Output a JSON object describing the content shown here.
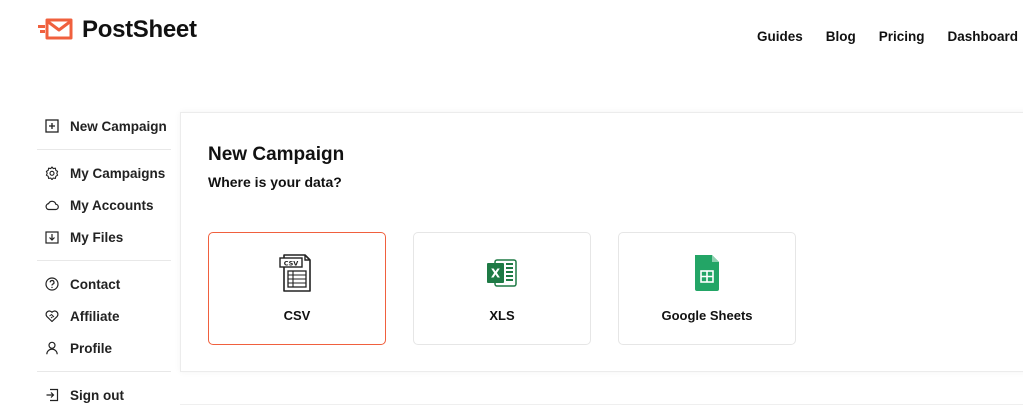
{
  "brand": {
    "name": "PostSheet",
    "color": "#f0603e"
  },
  "topnav": [
    {
      "label": "Guides"
    },
    {
      "label": "Blog"
    },
    {
      "label": "Pricing"
    },
    {
      "label": "Dashboard"
    }
  ],
  "sidebar": {
    "groups": [
      [
        {
          "label": "New Campaign",
          "icon": "plus-square-icon"
        }
      ],
      [
        {
          "label": "My Campaigns",
          "icon": "gear-icon"
        },
        {
          "label": "My Accounts",
          "icon": "cloud-icon"
        },
        {
          "label": "My Files",
          "icon": "download-folder-icon"
        }
      ],
      [
        {
          "label": "Contact",
          "icon": "question-circle-icon"
        },
        {
          "label": "Affiliate",
          "icon": "heart-handshake-icon"
        },
        {
          "label": "Profile",
          "icon": "user-icon"
        }
      ],
      [
        {
          "label": "Sign out",
          "icon": "sign-out-icon"
        }
      ]
    ]
  },
  "main": {
    "title": "New Campaign",
    "subtitle": "Where is your data?",
    "options": [
      {
        "label": "CSV",
        "icon": "csv-file-icon",
        "selected": true
      },
      {
        "label": "XLS",
        "icon": "excel-icon",
        "selected": false
      },
      {
        "label": "Google Sheets",
        "icon": "google-sheets-icon",
        "selected": false
      }
    ],
    "csv_icon_text": "CSV",
    "xls_icon_text": "X"
  },
  "colors": {
    "accent": "#f0603e",
    "excel": "#1e7a45",
    "sheets": "#23a566"
  }
}
